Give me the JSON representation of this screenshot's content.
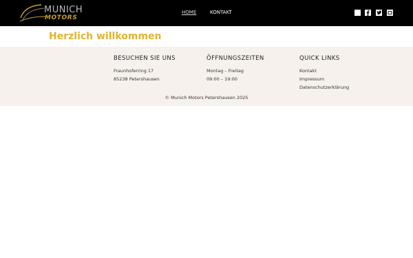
{
  "header": {
    "logo": {
      "line1": "MUNICH",
      "line2": "MOTORS"
    },
    "nav": [
      {
        "label": "HOME",
        "active": true
      },
      {
        "label": "KONTAKT",
        "active": false
      }
    ],
    "social_icons": [
      "square-icon",
      "facebook-icon",
      "twitter-icon",
      "tablet-icon"
    ]
  },
  "main": {
    "title": "Herzlich willkommen",
    "title_color": "#e1b42a"
  },
  "footer": {
    "background": "#f6f1ec",
    "visit": {
      "heading": "BESUCHEN SIE UNS",
      "street": "Fraunhoferring 17",
      "city": "85238 Petershausen"
    },
    "hours": {
      "heading": "ÖFFNUNGSZEITEN",
      "days": "Montag – Freitag",
      "times": "09:00  – 19:00"
    },
    "links": {
      "heading": "QUICK LINKS",
      "items": [
        "Kontakt",
        "Impressum",
        "Datenschutzerklärung"
      ]
    },
    "copyright": "© Munich Motors Petershausen 2025"
  }
}
